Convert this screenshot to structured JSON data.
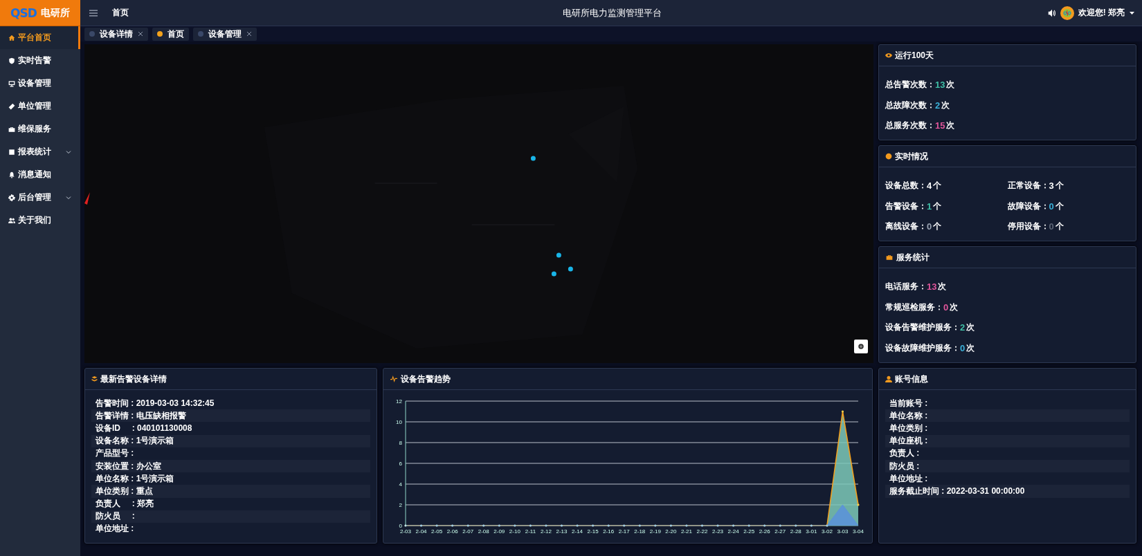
{
  "logo": {
    "mark": "QSD",
    "name": "电研所"
  },
  "header": {
    "breadcrumb": "首页",
    "title": "电研所电力监测管理平台",
    "greeting": "欢迎您! 郑亮"
  },
  "sidebar": {
    "items": [
      {
        "label": "平台首页",
        "kind": "home",
        "selected": true,
        "has_submenu": false
      },
      {
        "label": "实时告警",
        "kind": "shield",
        "selected": false,
        "has_submenu": false
      },
      {
        "label": "设备管理",
        "kind": "monitor",
        "selected": false,
        "has_submenu": false
      },
      {
        "label": "单位管理",
        "kind": "tag",
        "selected": false,
        "has_submenu": false
      },
      {
        "label": "维保服务",
        "kind": "briefcase",
        "selected": false,
        "has_submenu": false
      },
      {
        "label": "报表统计",
        "kind": "table",
        "selected": false,
        "has_submenu": true
      },
      {
        "label": "消息通知",
        "kind": "bell",
        "selected": false,
        "has_submenu": false
      },
      {
        "label": "后台管理",
        "kind": "gear",
        "selected": false,
        "has_submenu": true
      },
      {
        "label": "关于我们",
        "kind": "users",
        "selected": false,
        "has_submenu": false
      }
    ]
  },
  "tabs": [
    {
      "label": "设备详情",
      "selected": false,
      "closable": true
    },
    {
      "label": "首页",
      "selected": true,
      "closable": false
    },
    {
      "label": "设备管理",
      "selected": false,
      "closable": true
    }
  ],
  "running": {
    "title": "运行100天",
    "stats": [
      {
        "label": "总告警次数：",
        "value": "13",
        "unit": "次",
        "color": "#3fbfa6"
      },
      {
        "label": "总故障次数：",
        "value": "2",
        "unit": "次",
        "color": "#3ab0d8"
      },
      {
        "label": "总服务次数：",
        "value": "15",
        "unit": "次",
        "color": "#e0559a"
      }
    ]
  },
  "realtime": {
    "title": "实时情况",
    "stats": [
      {
        "label": "设备总数：",
        "value": "4",
        "unit": "个",
        "color": "#ffffff"
      },
      {
        "label": "正常设备：",
        "value": "3",
        "unit": "个",
        "color": "#ffffff"
      },
      {
        "label": "告警设备：",
        "value": "1",
        "unit": "个",
        "color": "#3fbfa6"
      },
      {
        "label": "故障设备：",
        "value": "0",
        "unit": "个",
        "color": "#3ab0d8"
      },
      {
        "label": "离线设备：",
        "value": "0",
        "unit": "个",
        "color": "#9aa3b2"
      },
      {
        "label": "停用设备：",
        "value": "0",
        "unit": "个",
        "color": "#5c6576"
      }
    ]
  },
  "service": {
    "title": "服务统计",
    "stats": [
      {
        "label": "电话服务：",
        "value": "13",
        "unit": "次",
        "color": "#e0559a"
      },
      {
        "label": "常规巡检服务：",
        "value": "0",
        "unit": "次",
        "color": "#e0559a"
      },
      {
        "label": "设备告警维护服务：",
        "value": "2",
        "unit": "次",
        "color": "#3fbfa6"
      },
      {
        "label": "设备故障维护服务：",
        "value": "0",
        "unit": "次",
        "color": "#3ab0d8"
      }
    ]
  },
  "alarm_detail": {
    "title": "最新告警设备详情",
    "rows": [
      "告警时间 : 2019-03-03 14:32:45",
      "告警详情 : 电压缺相报警",
      "设备ID     : 040101130008",
      "设备名称 : 1号演示箱",
      "产品型号 :",
      "安装位置 : 办公室",
      "单位名称 : 1号演示箱",
      "单位类别 : 重点",
      "负责人     : 郑亮",
      "防火员     :",
      "单位地址 :"
    ]
  },
  "trend": {
    "title": "设备告警趋势",
    "chart_data": {
      "type": "area",
      "categories": [
        "2-03",
        "2-04",
        "2-05",
        "2-06",
        "2-07",
        "2-08",
        "2-09",
        "2-10",
        "2-11",
        "2-12",
        "2-13",
        "2-14",
        "2-15",
        "2-16",
        "2-17",
        "2-18",
        "2-19",
        "2-20",
        "2-21",
        "2-22",
        "2-23",
        "2-24",
        "2-25",
        "2-26",
        "2-27",
        "2-28",
        "3-01",
        "3-02",
        "3-03",
        "3-04"
      ],
      "series": [
        {
          "color": "#7cc9b9",
          "values": [
            0,
            0,
            0,
            0,
            0,
            0,
            0,
            0,
            0,
            0,
            0,
            0,
            0,
            0,
            0,
            0,
            0,
            0,
            0,
            0,
            0,
            0,
            0,
            0,
            0,
            0,
            0,
            0,
            11,
            2
          ]
        },
        {
          "color": "#5b93d8",
          "values": [
            0,
            0,
            0,
            0,
            0,
            0,
            0,
            0,
            0,
            0,
            0,
            0,
            0,
            0,
            0,
            0,
            0,
            0,
            0,
            0,
            0,
            0,
            0,
            0,
            0,
            0,
            0,
            0,
            2,
            0
          ]
        }
      ],
      "grid": true,
      "ylim": [
        0,
        12
      ],
      "yticks": [
        0,
        2,
        4,
        6,
        8,
        10,
        12
      ]
    }
  },
  "account": {
    "title": "账号信息",
    "rows": [
      "当前账号 :",
      "单位名称 :",
      "单位类别 :",
      "单位座机 :",
      "负责人 :",
      "防火员 :",
      "单位地址 :",
      "服务截止时间 : 2022-03-31 00:00:00"
    ]
  }
}
